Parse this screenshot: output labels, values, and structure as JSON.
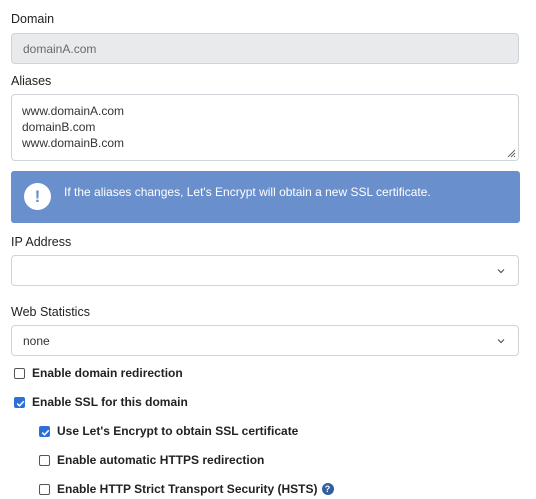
{
  "domain": {
    "label": "Domain",
    "value": "domainA.com"
  },
  "aliases": {
    "label": "Aliases",
    "lines": [
      "www.domainA.com",
      "domainB.com",
      "www.domainB.com"
    ]
  },
  "alert": {
    "icon": "exclamation-icon",
    "text": "If the aliases changes, Let's Encrypt will obtain a new SSL certificate.",
    "color": "#6a8fcd"
  },
  "ip_address": {
    "label": "IP Address",
    "value": ""
  },
  "web_statistics": {
    "label": "Web Statistics",
    "value": "none"
  },
  "options": [
    {
      "label": "Enable domain redirection",
      "checked": false
    },
    {
      "label": "Enable SSL for this domain",
      "checked": true
    },
    {
      "label": "Use Let's Encrypt to obtain SSL certificate",
      "checked": true
    },
    {
      "label": "Enable automatic HTTPS redirection",
      "checked": false
    },
    {
      "label": "Enable HTTP Strict Transport Security (HSTS)",
      "checked": false,
      "help": "?"
    }
  ],
  "colors": {
    "accent": "#2e6fd8",
    "alert_bg": "#6a8fcd",
    "help_icon": "#2f5f9e"
  }
}
